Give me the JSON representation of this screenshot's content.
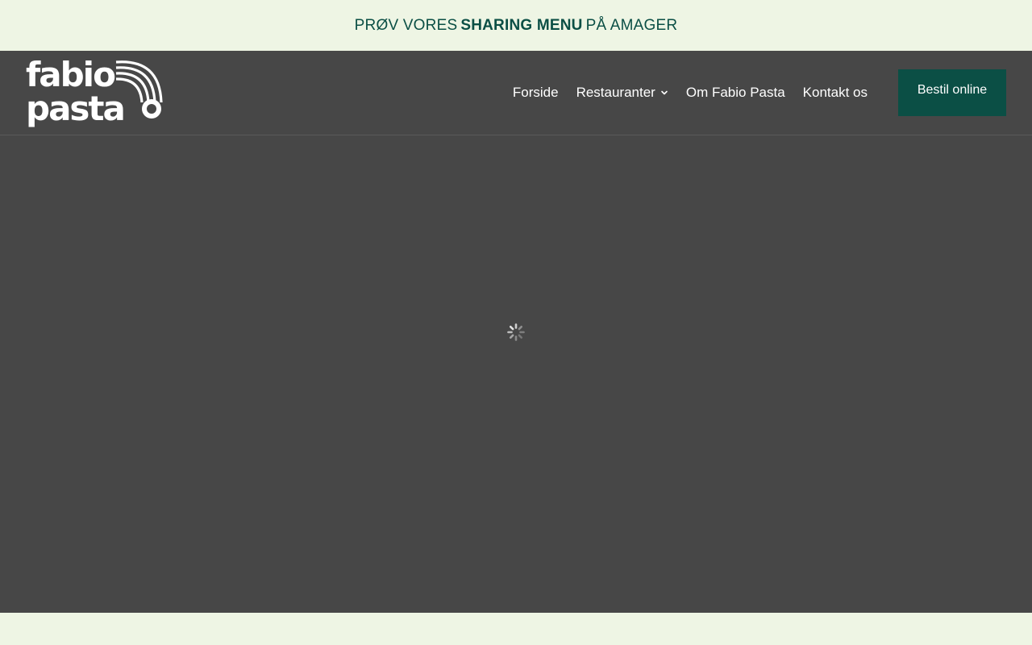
{
  "banner": {
    "prefix": "PRØV VORES",
    "highlight": "SHARING MENU",
    "suffix": "PÅ AMAGER"
  },
  "logo": {
    "line1": "fabio",
    "line2": "pasta"
  },
  "nav": {
    "items": [
      {
        "label": "Forside"
      },
      {
        "label": "Restauranter"
      },
      {
        "label": "Om Fabio Pasta"
      },
      {
        "label": "Kontakt os"
      }
    ]
  },
  "cta": {
    "label": "Bestil online"
  },
  "colors": {
    "brand_green": "#0b4f45",
    "banner_bg": "#eef5e4",
    "header_bg": "#474747",
    "text_light": "#ffffff"
  },
  "icons": {
    "dropdown": "chevron-down-icon",
    "loading": "loading-spinner-icon"
  }
}
